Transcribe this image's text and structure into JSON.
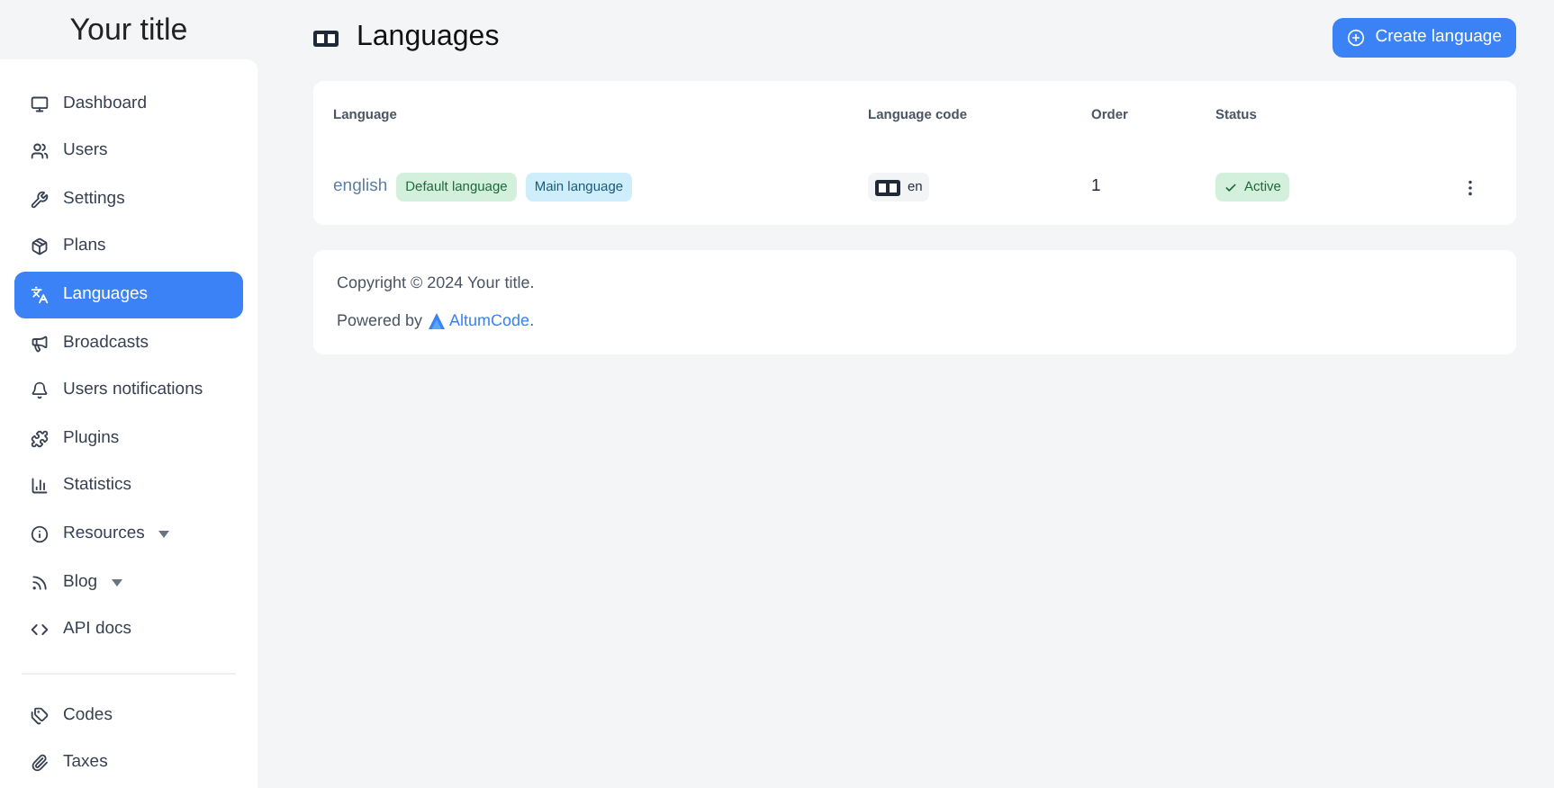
{
  "brand": "Your title",
  "sidebar": {
    "groups": [
      {
        "items": [
          {
            "label": "Dashboard",
            "selected": false,
            "dropdown": false
          },
          {
            "label": "Users",
            "selected": false,
            "dropdown": false
          },
          {
            "label": "Settings",
            "selected": false,
            "dropdown": false
          },
          {
            "label": "Plans",
            "selected": false,
            "dropdown": false
          },
          {
            "label": "Languages",
            "selected": true,
            "dropdown": false
          },
          {
            "label": "Broadcasts",
            "selected": false,
            "dropdown": false
          },
          {
            "label": "Users notifications",
            "selected": false,
            "dropdown": false
          },
          {
            "label": "Plugins",
            "selected": false,
            "dropdown": false
          },
          {
            "label": "Statistics",
            "selected": false,
            "dropdown": false
          },
          {
            "label": "Resources",
            "selected": false,
            "dropdown": true
          },
          {
            "label": "Blog",
            "selected": false,
            "dropdown": true
          },
          {
            "label": "API docs",
            "selected": false,
            "dropdown": false
          }
        ]
      },
      {
        "items": [
          {
            "label": "Codes",
            "selected": false,
            "dropdown": false
          },
          {
            "label": "Taxes",
            "selected": false,
            "dropdown": false
          }
        ]
      }
    ]
  },
  "page": {
    "title": "Languages",
    "create_button": "Create language"
  },
  "table": {
    "columns": [
      "Language",
      "Language code",
      "Order",
      "Status"
    ],
    "rows": [
      {
        "name": "english",
        "badges": [
          {
            "label": "Default language",
            "kind": "default"
          },
          {
            "label": "Main language",
            "kind": "main"
          }
        ],
        "code": "en",
        "order": "1",
        "status": "Active",
        "active": true
      }
    ]
  },
  "footer": {
    "copyright": "Copyright © 2024 Your title.",
    "powered_prefix": "Powered by",
    "powered_link": "AltumCode",
    "powered_suffix": "."
  }
}
